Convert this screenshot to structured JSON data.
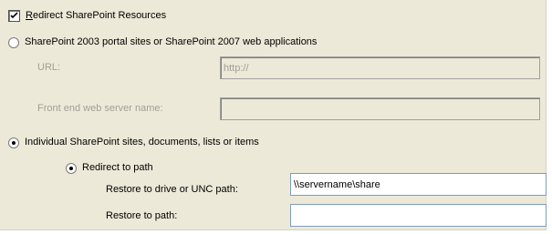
{
  "redirect_checkbox": {
    "label_accel": "R",
    "label_rest": "edirect SharePoint Resources",
    "checked": true
  },
  "option_portal": {
    "label": "SharePoint 2003 portal sites or SharePoint 2007 web applications",
    "selected": false,
    "url_label": "URL:",
    "url_value": "http://",
    "frontend_label": "Front end web server name:",
    "frontend_value": ""
  },
  "option_individual": {
    "label": "Individual SharePoint sites, documents, lists or items",
    "selected": true,
    "redirect_to_path": {
      "label": "Redirect to path",
      "selected": true,
      "restore_drive_label": "Restore to drive or UNC path:",
      "restore_drive_value": "\\\\servername\\share",
      "restore_path_label": "Restore to path:",
      "restore_path_value": ""
    }
  }
}
